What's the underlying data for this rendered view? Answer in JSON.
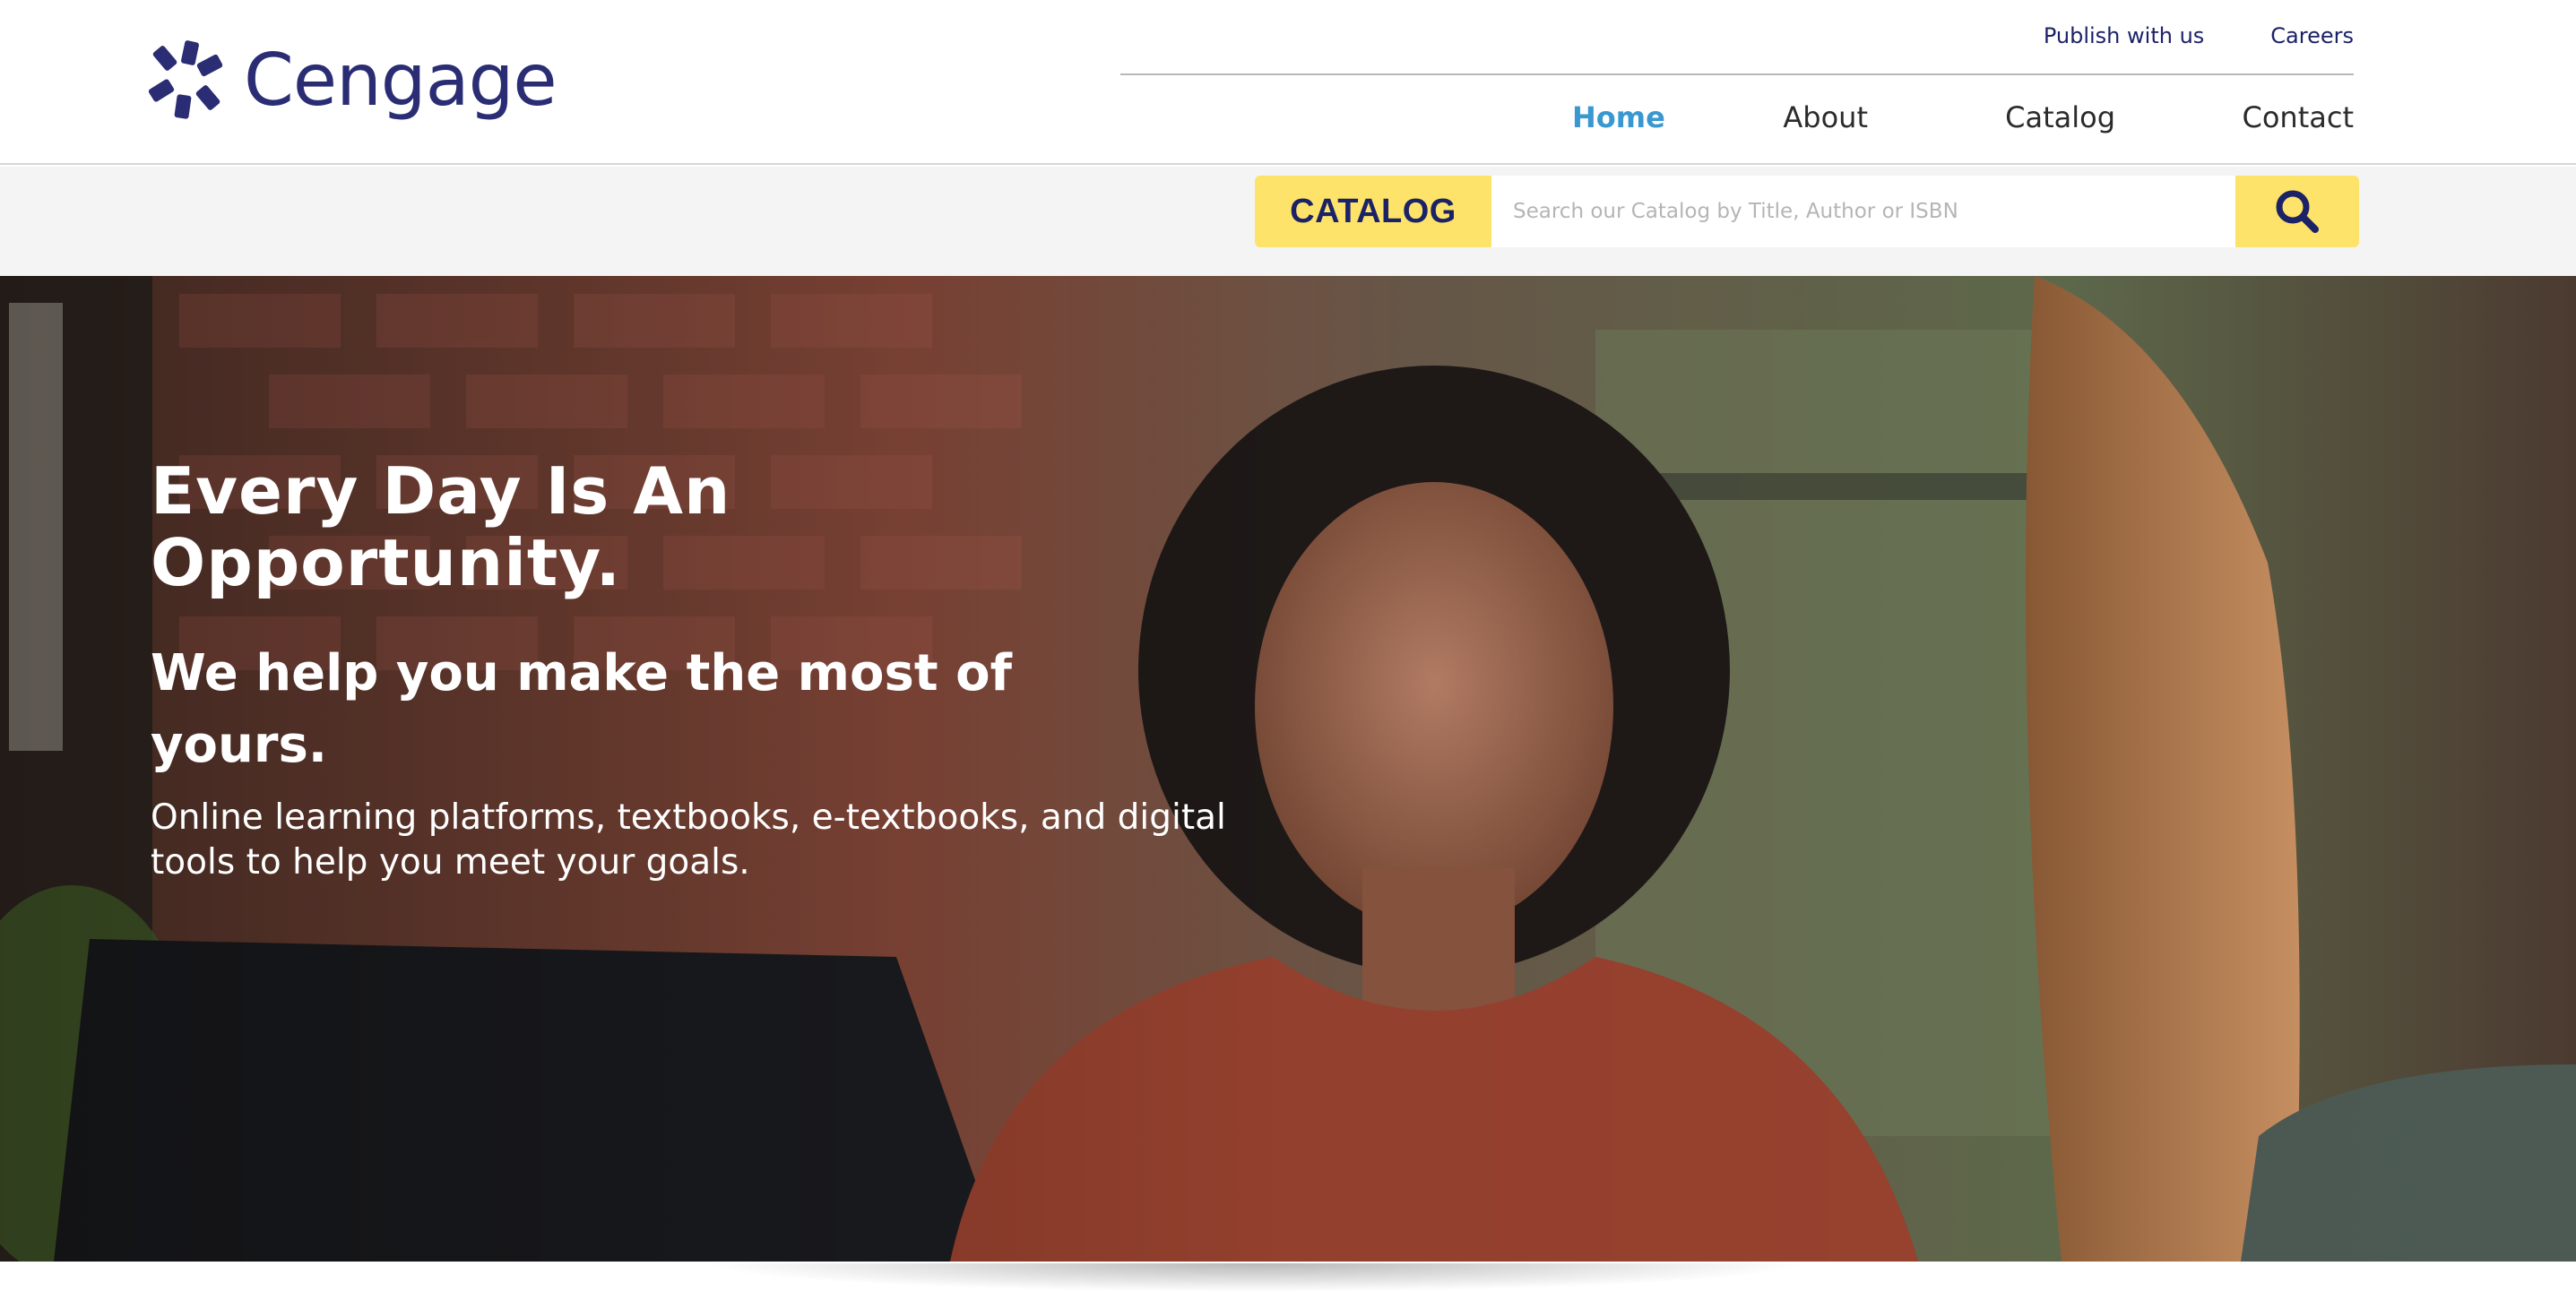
{
  "brand": {
    "name": "Cengage",
    "color": "#2a2d73"
  },
  "utility_nav": {
    "publish": "Publish with us",
    "careers": "Careers"
  },
  "main_nav": {
    "home": "Home",
    "about": "About",
    "catalog": "Catalog",
    "contact": "Contact",
    "active": "Home",
    "active_color": "#3a98d0"
  },
  "search": {
    "tag": "CATALOG",
    "placeholder": "Search our Catalog by Title, Author or ISBN",
    "button_icon": "search-icon",
    "accent_color": "#fde36a"
  },
  "hero": {
    "title": "Every Day Is An Opportunity.",
    "subtitle": "We help you make the most of yours.",
    "body": "Online learning platforms, textbooks, e-textbooks, and digital tools to help you meet your goals."
  }
}
